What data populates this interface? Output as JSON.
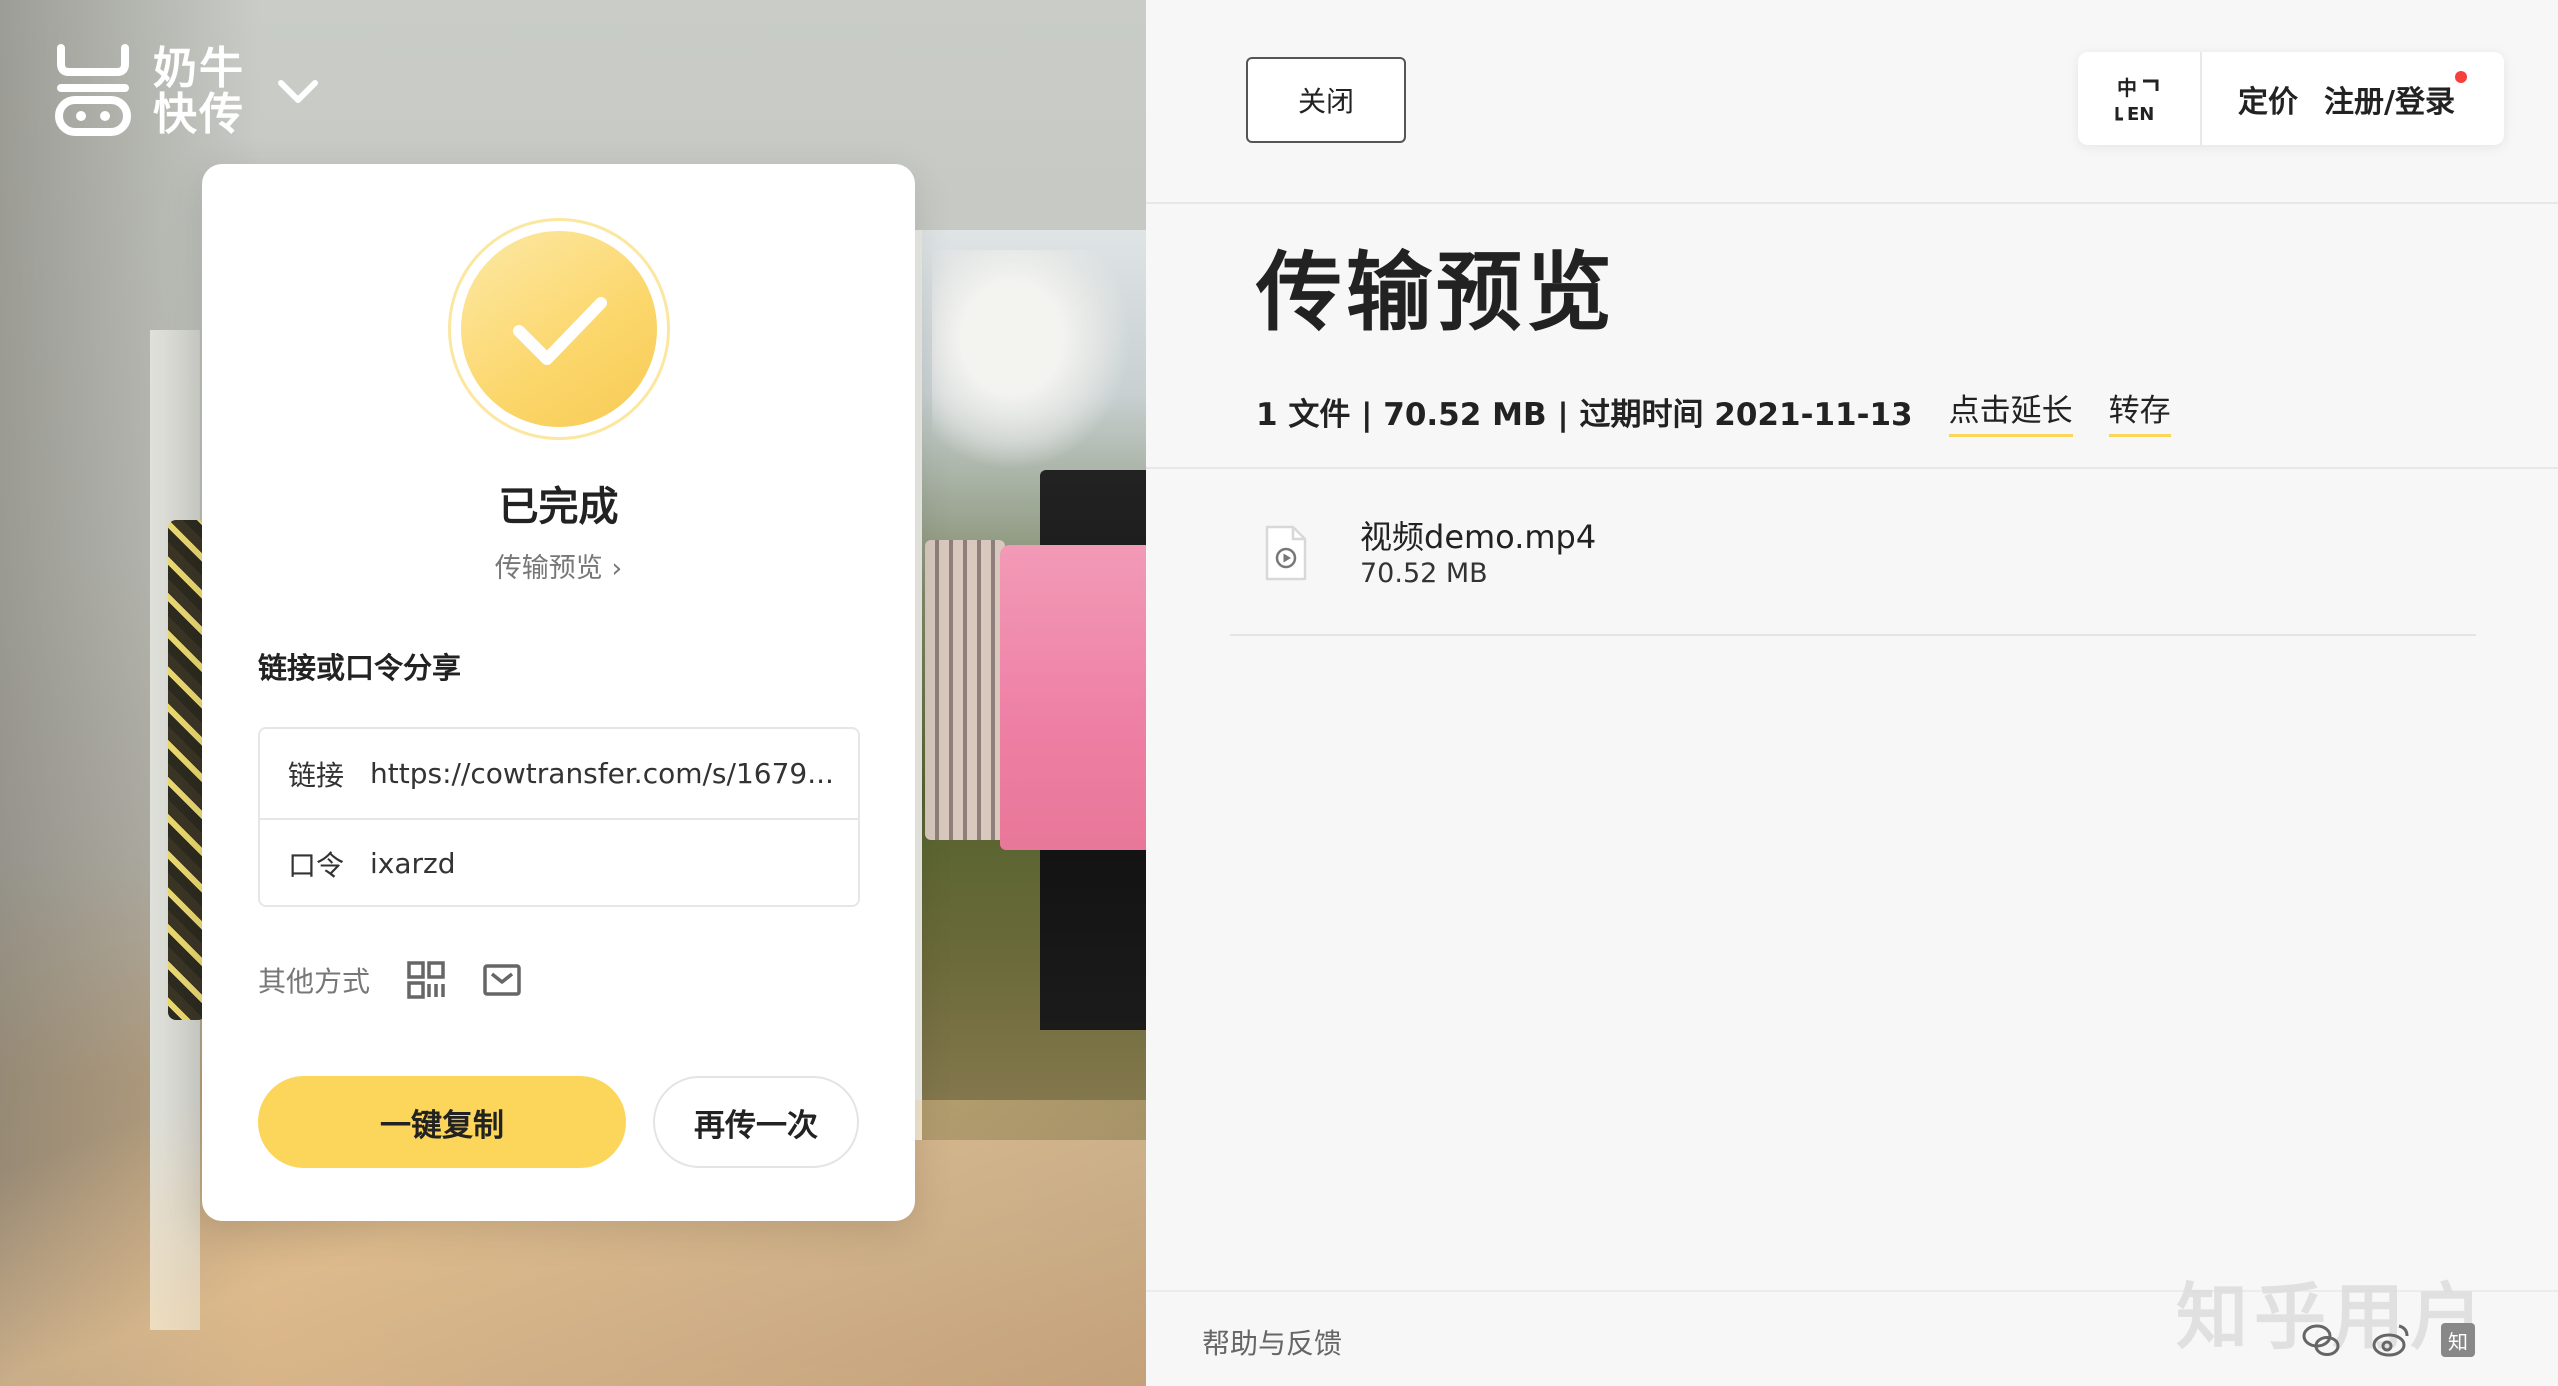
{
  "logo": {
    "line1": "奶牛",
    "line2": "快传"
  },
  "card": {
    "status": "已完成",
    "preview_link": "传输预览 ›",
    "share_label": "链接或口令分享",
    "link_key": "链接",
    "link_value": "https://cowtransfer.com/s/1679...",
    "code_key": "口令",
    "code_value": "ixarzd",
    "other_label": "其他方式",
    "copy_button": "一键复制",
    "again_button": "再传一次",
    "accent_color": "#fbd65a"
  },
  "panel": {
    "close_button": "关闭",
    "nav": {
      "pricing": "定价",
      "login": "注册/登录",
      "lang_icon": "中/EN"
    },
    "title": "传输预览",
    "meta": {
      "summary": "1 文件 | 70.52 MB | 过期时间 2021-11-13",
      "extend": "点击延长",
      "save": "转存"
    },
    "files": [
      {
        "name": "视频demo.mp4",
        "size": "70.52 MB",
        "icon": "video-file-icon"
      }
    ],
    "footer": {
      "help": "帮助与反馈",
      "watermark": "知乎用户",
      "zhihu_badge": "知"
    }
  }
}
